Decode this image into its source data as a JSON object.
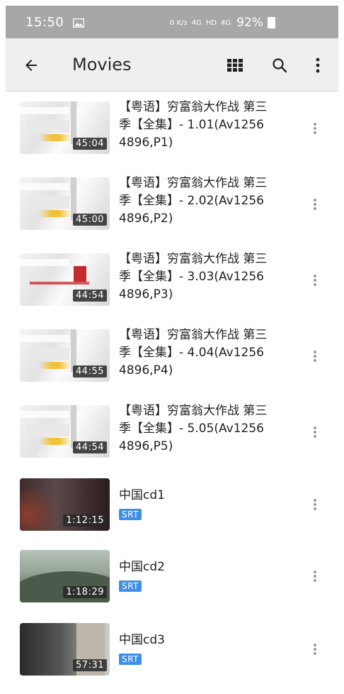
{
  "status_bar": {
    "time": "15:50",
    "network_info": "0 K/s",
    "signal1": "4G",
    "hd_label": "HD",
    "signal2": "4G",
    "battery_percent": "92%"
  },
  "toolbar": {
    "title": "Movies",
    "back_icon": "arrow-back-icon",
    "grid_icon": "grid-view-icon",
    "search_icon": "search-icon",
    "overflow_icon": "more-vert-icon"
  },
  "videos": [
    {
      "title": "【粤语】穷富翁大作战 第三季【全集】- 1.01(Av12564896,P1)",
      "duration": "45:04",
      "badge": "",
      "thumb_style": "light"
    },
    {
      "title": "【粤语】穷富翁大作战 第三季【全集】- 2.02(Av12564896,P2)",
      "duration": "45:00",
      "badge": "",
      "thumb_style": "light"
    },
    {
      "title": "【粤语】穷富翁大作战 第三季【全集】- 3.03(Av12564896,P3)",
      "duration": "44:54",
      "badge": "",
      "thumb_style": "light-red"
    },
    {
      "title": "【粤语】穷富翁大作战 第三季【全集】- 4.04(Av12564896,P4)",
      "duration": "44:55",
      "badge": "",
      "thumb_style": "light"
    },
    {
      "title": "【粤语】穷富翁大作战 第三季【全集】- 5.05(Av12564896,P5)",
      "duration": "44:54",
      "badge": "",
      "thumb_style": "light"
    },
    {
      "title": "中国cd1",
      "duration": "1:12:15",
      "badge": "SRT",
      "thumb_style": "dark-purple"
    },
    {
      "title": "中国cd2",
      "duration": "1:18:29",
      "badge": "SRT",
      "thumb_style": "green-hills"
    },
    {
      "title": "中国cd3",
      "duration": "57:31",
      "badge": "SRT",
      "thumb_style": "street"
    }
  ],
  "colors": {
    "toolbar_bg": "#efefef",
    "status_bar_bg": "#a7a7a7",
    "badge_blue": "#3f8fe6"
  }
}
